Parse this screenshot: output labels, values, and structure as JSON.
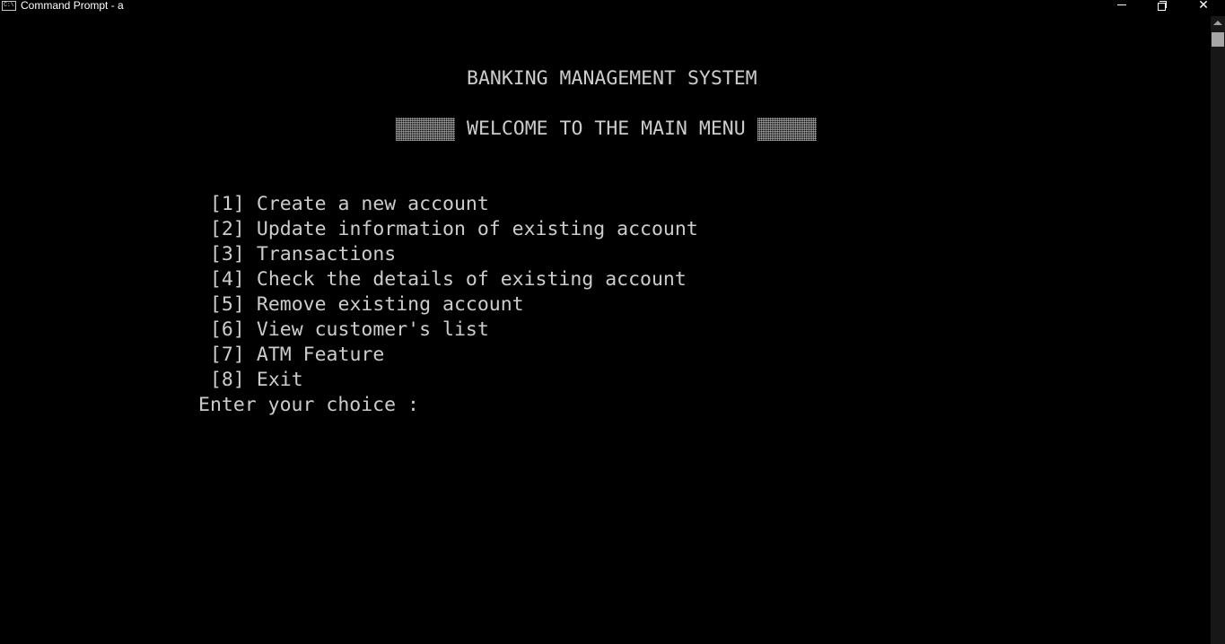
{
  "window": {
    "title": "Command Prompt - a",
    "icon_text": "C:\\",
    "controls": [
      "minimize-icon",
      "restore-icon",
      "close-icon"
    ],
    "close_glyph": "✕"
  },
  "console": {
    "system_title": "BANKING MANAGEMENT SYSTEM",
    "menu_header": "WELCOME TO THE MAIN MENU",
    "menu_items": [
      {
        "number": "[1]",
        "label": "Create a new account"
      },
      {
        "number": "[2]",
        "label": "Update information of existing account"
      },
      {
        "number": "[3]",
        "label": "Transactions"
      },
      {
        "number": "[4]",
        "label": "Check the details of existing account"
      },
      {
        "number": "[5]",
        "label": "Remove existing account"
      },
      {
        "number": "[6]",
        "label": "View customer's list"
      },
      {
        "number": "[7]",
        "label": "ATM Feature"
      },
      {
        "number": "[8]",
        "label": "Exit"
      }
    ],
    "prompt": "Enter your choice :"
  },
  "colors": {
    "background": "#000000",
    "text": "#cccccc"
  }
}
